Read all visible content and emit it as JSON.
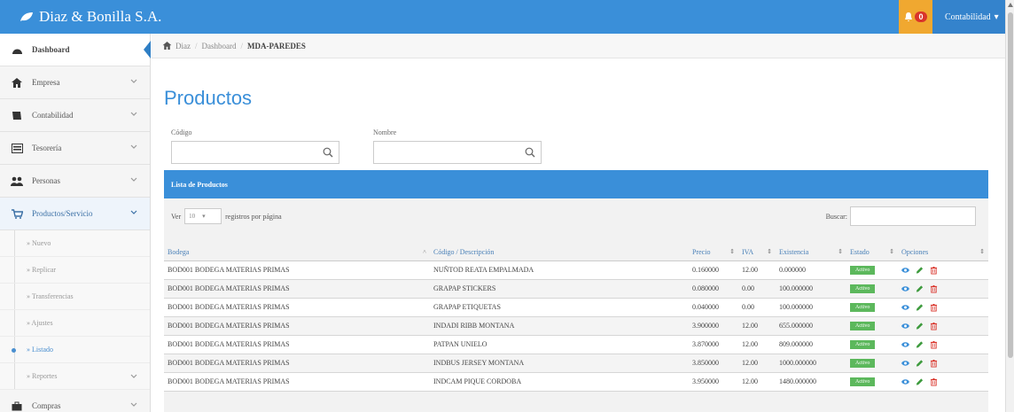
{
  "app": {
    "brand": "Diaz & Bonilla S.A.",
    "notifications": "0",
    "user_menu": "Contabilidad"
  },
  "sidebar": {
    "items": [
      {
        "label": "Dashboard"
      },
      {
        "label": "Empresa"
      },
      {
        "label": "Contabilidad"
      },
      {
        "label": "Tesorería"
      },
      {
        "label": "Personas"
      },
      {
        "label": "Productos/Servicio"
      }
    ],
    "sub_items": [
      {
        "label": "» Nuevo"
      },
      {
        "label": "» Replicar"
      },
      {
        "label": "» Transferencias"
      },
      {
        "label": "» Ajustes"
      },
      {
        "label": "» Listado"
      },
      {
        "label": "» Reportes"
      }
    ],
    "last_item": {
      "label": "Compras"
    }
  },
  "breadcrumb": {
    "home": "Diaz",
    "dashboard": "Dashboard",
    "current": "MDA-PAREDES"
  },
  "page": {
    "title": "Productos"
  },
  "filters": {
    "code_label": "Código",
    "name_label": "Nombre"
  },
  "panel": {
    "title": "Lista de Productos",
    "show_label": "Ver",
    "page_size": "10",
    "per_page_label": "registros por página",
    "search_label": "Buscar:"
  },
  "table": {
    "headers": [
      "Bodega",
      "Código / Descripción",
      "Precio",
      "IVA",
      "Existencia",
      "Estado",
      "Opciones"
    ],
    "rows": [
      [
        "BOD001 BODEGA MATERIAS PRIMAS",
        "NUÑTOD REATA EMPALMADA",
        "0.160000",
        "12.00",
        "0.000000",
        "Activo"
      ],
      [
        "BOD001 BODEGA MATERIAS PRIMAS",
        "GRAPAP STICKERS",
        "0.080000",
        "0.00",
        "100.000000",
        "Activo"
      ],
      [
        "BOD001 BODEGA MATERIAS PRIMAS",
        "GRAPAP ETIQUETAS",
        "0.040000",
        "0.00",
        "100.000000",
        "Activo"
      ],
      [
        "BOD001 BODEGA MATERIAS PRIMAS",
        "INDADI RIBB MONTANA",
        "3.900000",
        "12.00",
        "655.000000",
        "Activo"
      ],
      [
        "BOD001 BODEGA MATERIAS PRIMAS",
        "PATPAN UNIELO",
        "3.870000",
        "12.00",
        "809.000000",
        "Activo"
      ],
      [
        "BOD001 BODEGA MATERIAS PRIMAS",
        "INDBUS JERSEY MONTANA",
        "3.850000",
        "12.00",
        "1000.000000",
        "Activo"
      ],
      [
        "BOD001 BODEGA MATERIAS PRIMAS",
        "INDCAM PIQUE CORDOBA",
        "3.950000",
        "12.00",
        "1480.000000",
        "Activo"
      ]
    ]
  },
  "colors": {
    "primary": "#3a8fd9",
    "status_active": "#5cb85c",
    "notify": "#f0a830",
    "edit": "#3c9a3c",
    "delete": "#d9342b"
  }
}
